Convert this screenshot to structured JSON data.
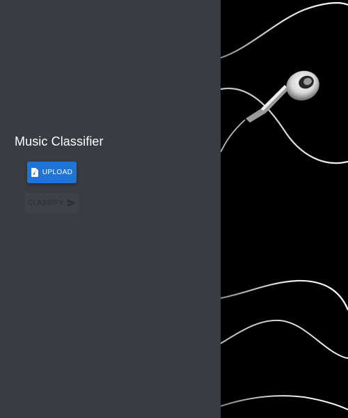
{
  "app": {
    "title": "Music Classifier"
  },
  "actions": {
    "upload_label": "UPLOAD",
    "upload_icon": "audio-file-icon",
    "classify_label": "CLASSIFY",
    "classify_icon": "send-icon",
    "classify_enabled": false
  },
  "hero_image": {
    "subject": "white earphones on black background"
  },
  "colors": {
    "panel_background": "#393c43",
    "primary_button": "#1e75d6",
    "disabled_button": "#3e4148",
    "hero_background": "#000000"
  }
}
